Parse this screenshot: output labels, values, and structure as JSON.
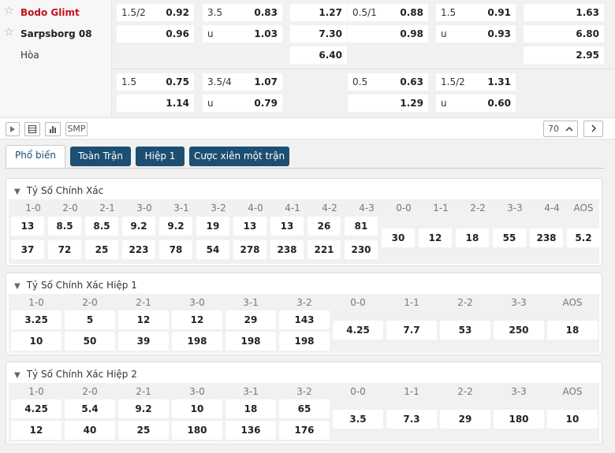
{
  "match": {
    "home": "Bodo Glimt",
    "away": "Sarpsborg 08",
    "draw": "Hòa",
    "home_color": "#c0141e"
  },
  "odds_rows": [
    {
      "ah_home_line": "1.5/2",
      "ah_home": "0.92",
      "ah_away": "0.96",
      "ou_line": "3.5",
      "ou_over": "0.83",
      "ou_u": "u",
      "ou_under": "1.03",
      "x_home": "1.27",
      "x_away": "7.30",
      "x_draw": "6.40",
      "h1_ah_line": "0.5/1",
      "h1_ah_home": "0.88",
      "h1_ah_away": "0.98",
      "h1_ou_line": "1.5",
      "h1_ou_over": "0.91",
      "h1_ou_u": "u",
      "h1_ou_under": "0.93",
      "h1_x_home": "1.63",
      "h1_x_away": "6.80",
      "h1_x_draw": "2.95"
    },
    {
      "ah_home_line": "1.5",
      "ah_home": "0.75",
      "ah_away": "1.14",
      "ou_line": "3.5/4",
      "ou_over": "1.07",
      "ou_u": "u",
      "ou_under": "0.79",
      "h1_ah_line": "0.5",
      "h1_ah_home": "0.63",
      "h1_ah_away": "1.29",
      "h1_ou_line": "1.5/2",
      "h1_ou_over": "1.31",
      "h1_ou_u": "u",
      "h1_ou_under": "0.60"
    }
  ],
  "toolbar": {
    "play_icon": "play-icon",
    "list_icon": "list-icon",
    "chart_icon": "chart-icon",
    "smp": "SMP",
    "count": "70"
  },
  "tabs": [
    "Phổ biến",
    "Toàn Trận",
    "Hiệp 1",
    "Cược xiên một trận"
  ],
  "sections": [
    {
      "title": "Tỷ Số Chính Xác",
      "home_scores": [
        "1-0",
        "2-0",
        "2-1",
        "3-0",
        "3-1",
        "3-2",
        "4-0",
        "4-1",
        "4-2",
        "4-3"
      ],
      "home_odds": [
        "13",
        "8.5",
        "8.5",
        "9.2",
        "9.2",
        "19",
        "13",
        "13",
        "26",
        "81"
      ],
      "away_odds": [
        "37",
        "72",
        "25",
        "223",
        "78",
        "54",
        "278",
        "238",
        "221",
        "230"
      ],
      "draw_scores": [
        "0-0",
        "1-1",
        "2-2",
        "3-3",
        "4-4",
        "AOS"
      ],
      "draw_odds": [
        "30",
        "12",
        "18",
        "55",
        "238",
        "5.2"
      ]
    },
    {
      "title": "Tỷ Số Chính Xác Hiệp 1",
      "home_scores": [
        "1-0",
        "2-0",
        "2-1",
        "3-0",
        "3-1",
        "3-2"
      ],
      "home_odds": [
        "3.25",
        "5",
        "12",
        "12",
        "29",
        "143"
      ],
      "away_odds": [
        "10",
        "50",
        "39",
        "198",
        "198",
        "198"
      ],
      "draw_scores": [
        "0-0",
        "1-1",
        "2-2",
        "3-3",
        "AOS"
      ],
      "draw_odds": [
        "4.25",
        "7.7",
        "53",
        "250",
        "18"
      ]
    },
    {
      "title": "Tỷ Số Chính Xác Hiệp 2",
      "home_scores": [
        "1-0",
        "2-0",
        "2-1",
        "3-0",
        "3-1",
        "3-2"
      ],
      "home_odds": [
        "4.25",
        "5.4",
        "9.2",
        "10",
        "18",
        "65"
      ],
      "away_odds": [
        "12",
        "40",
        "25",
        "180",
        "136",
        "176"
      ],
      "draw_scores": [
        "0-0",
        "1-1",
        "2-2",
        "3-3",
        "AOS"
      ],
      "draw_odds": [
        "3.5",
        "7.3",
        "29",
        "180",
        "10"
      ]
    }
  ]
}
